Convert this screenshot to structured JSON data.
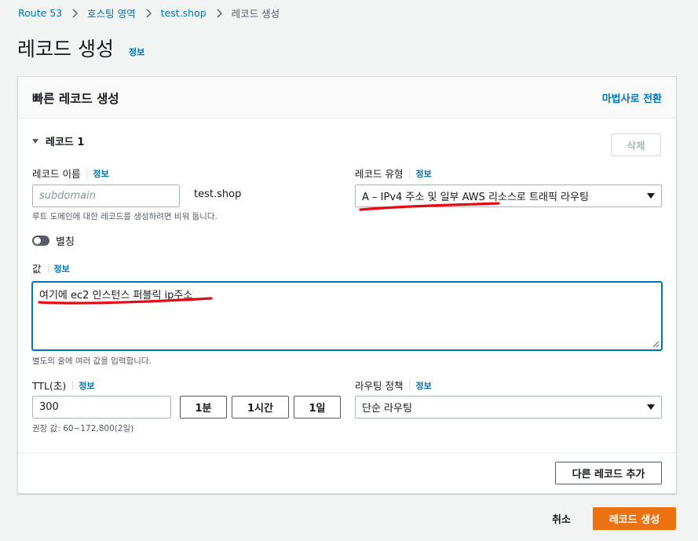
{
  "breadcrumb": {
    "items": [
      "Route 53",
      "호스팅 영역",
      "test.shop"
    ],
    "current": "레코드 생성"
  },
  "page": {
    "title": "레코드 생성",
    "info": "정보"
  },
  "card": {
    "title": "빠른 레코드 생성",
    "wizard_link": "마법사로 전환",
    "record_header": "레코드 1",
    "delete_label": "삭제",
    "record_name": {
      "label": "레코드 이름",
      "info": "정보",
      "placeholder": "subdomain",
      "suffix": "test.shop",
      "hint": "루트 도메인에 대한 레코드를 생성하려면 비워 둡니다."
    },
    "record_type": {
      "label": "레코드 유형",
      "info": "정보",
      "selected": "A – IPv4 주소 및 일부 AWS 리소스로 트래픽 라우팅"
    },
    "alias": {
      "label": "별칭",
      "enabled": false
    },
    "value": {
      "label": "값",
      "info": "정보",
      "text": "여기에 ec2 인스턴스 퍼블릭 ip주소",
      "hint": "별도의 줄에 여러 값을 입력합니다."
    },
    "ttl": {
      "label": "TTL(초)",
      "info": "정보",
      "value": "300",
      "buttons": [
        "1분",
        "1시간",
        "1일"
      ],
      "hint": "권장 값: 60~172,800(2일)"
    },
    "routing": {
      "label": "라우팅 정책",
      "info": "정보",
      "selected": "단순 라우팅"
    },
    "add_record": "다른 레코드 추가"
  },
  "footer": {
    "cancel": "취소",
    "create": "레코드 생성"
  },
  "colors": {
    "link": "#0073bb",
    "primary": "#ec7211",
    "annotation": "#e50914"
  },
  "icons": [
    "chevron-right-icon",
    "caret-down-icon",
    "dropdown-arrow-icon",
    "resize-handle-icon"
  ]
}
